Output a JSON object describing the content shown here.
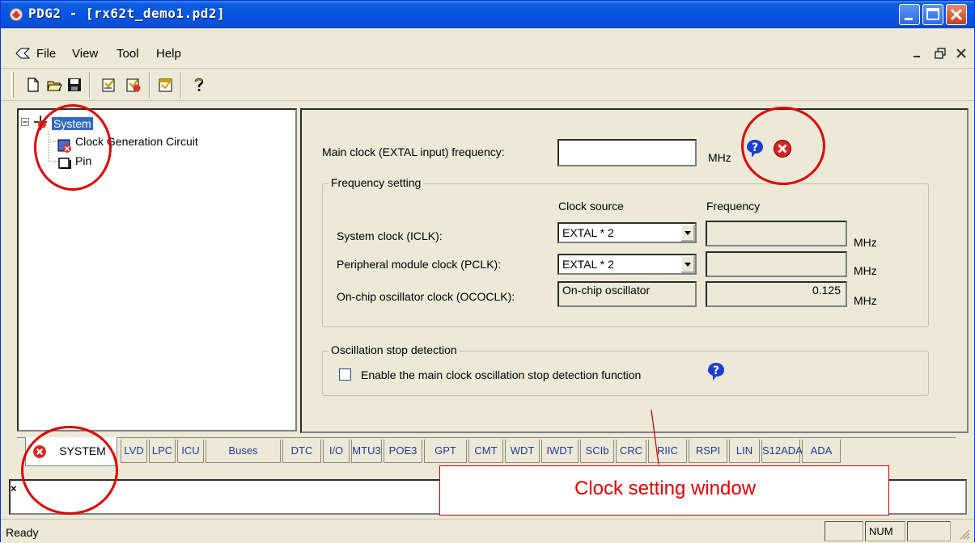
{
  "window": {
    "title": "PDG2 - [rx62t_demo1.pd2]"
  },
  "menu": {
    "items": [
      "File",
      "View",
      "Tool",
      "Help"
    ]
  },
  "tree": {
    "root": "System",
    "children": [
      "Clock Generation Circuit",
      "Pin"
    ]
  },
  "clock": {
    "main_label": "Main clock (EXTAL input) frequency:",
    "main_value": "",
    "unit": "MHz",
    "freq_group_title": "Frequency setting",
    "col_source": "Clock source",
    "col_frequency": "Frequency",
    "rows": [
      {
        "label": "System clock (ICLK):",
        "source": "EXTAL * 2",
        "frequency": "",
        "unit": "MHz"
      },
      {
        "label": "Peripheral module clock (PCLK):",
        "source": "EXTAL * 2",
        "frequency": "",
        "unit": "MHz"
      },
      {
        "label": "On-chip oscillator clock (OCOCLK):",
        "source": "On-chip oscillator",
        "frequency": "0.125",
        "unit": "MHz"
      }
    ],
    "osc_group_title": "Oscillation stop detection",
    "osc_checkbox_label": "Enable the main clock oscillation stop detection function"
  },
  "tabs": [
    "SYSTEM",
    "LVD",
    "LPC",
    "ICU",
    "Buses",
    "DTC",
    "I/O",
    "MTU3",
    "POE3",
    "GPT",
    "CMT",
    "WDT",
    "IWDT",
    "SCIb",
    "CRC",
    "RIIC",
    "RSPI",
    "LIN",
    "S12ADA",
    "ADA"
  ],
  "output": {
    "close_glyph": "×"
  },
  "status": {
    "text": "Ready",
    "num": "NUM"
  },
  "annotation": {
    "callout": "Clock setting window"
  },
  "colors": {
    "titlebar": "#0554e3",
    "annotation": "#e00000",
    "selection": "#316ac5"
  }
}
